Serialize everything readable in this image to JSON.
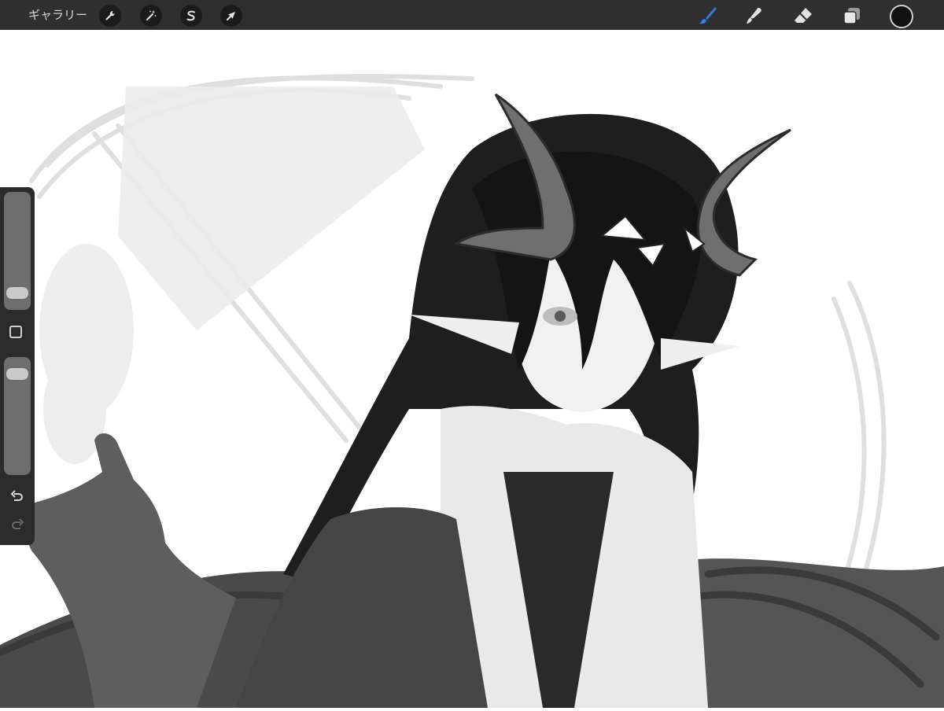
{
  "topbar": {
    "gallery_label": "ギャラリー",
    "left_tools": [
      {
        "icon": "wrench-icon"
      },
      {
        "icon": "magic-wand-icon"
      },
      {
        "icon": "selection-s-icon"
      },
      {
        "icon": "arrow-cursor-icon"
      }
    ],
    "right_tools": [
      {
        "icon": "brush-icon",
        "active": true
      },
      {
        "icon": "smudge-icon"
      },
      {
        "icon": "eraser-icon"
      },
      {
        "icon": "layers-icon"
      }
    ],
    "color_well": "#111111"
  },
  "sidebar": {
    "brush_size_level": 0.2,
    "opacity_level": 0.85,
    "icons": [
      "modify-square-icon",
      "undo-icon",
      "redo-icon"
    ]
  },
  "colors": {
    "brush_active": "#2f7fe6",
    "toolbar_bg": "#2f2f2f",
    "sidebar_bg": "#2b2b2b"
  }
}
